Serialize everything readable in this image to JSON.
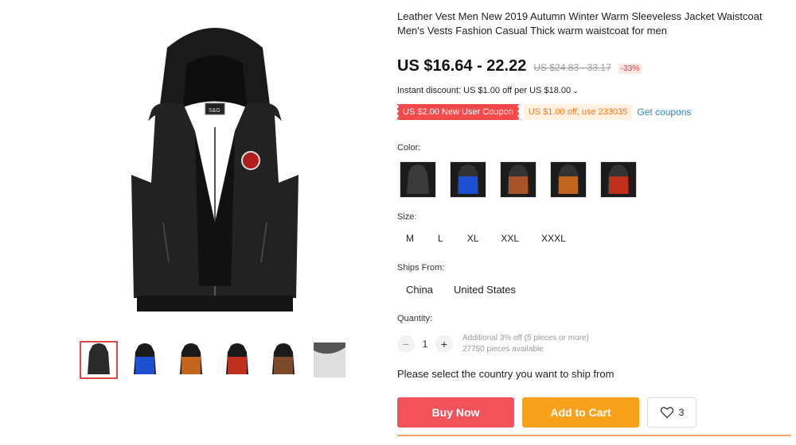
{
  "product": {
    "title": "Leather Vest Men New 2019 Autumn Winter Warm Sleeveless Jacket Waistcoat Men's Vests Fashion Casual Thick warm waistcoat for men",
    "price": "US $16.64 - 22.22",
    "old_price": "US $24.83 - 33.17",
    "discount": "-33%",
    "instant_discount": "Instant discount: US $1.00 off per US $18.00",
    "brand_tag": "S&G"
  },
  "coupons": {
    "new_user": "US $2.00 New User Coupon",
    "store": "US $1.00 off, use 233035",
    "get_label": "Get coupons"
  },
  "color": {
    "label": "Color:",
    "options": [
      {
        "name": "black",
        "color": "#2a2a2a"
      },
      {
        "name": "blue",
        "color": "#1e4fd0"
      },
      {
        "name": "brown",
        "color": "#a7542b"
      },
      {
        "name": "orange",
        "color": "#c3641f"
      },
      {
        "name": "red",
        "color": "#c0301f"
      }
    ]
  },
  "size": {
    "label": "Size:",
    "options": [
      "M",
      "L",
      "XL",
      "XXL",
      "XXXL"
    ]
  },
  "ships_from": {
    "label": "Ships From:",
    "options": [
      "China",
      "United States"
    ]
  },
  "quantity": {
    "label": "Quantity:",
    "value": "1",
    "minus": "−",
    "plus": "+",
    "note_line1": "Additional 3% off (5 pieces or more)",
    "note_line2": "27750 pieces available"
  },
  "ship_notice": "Please select the country you want to ship from",
  "actions": {
    "buy_now": "Buy Now",
    "add_to_cart": "Add to Cart",
    "wishlist_count": "3"
  },
  "thumbnails": [
    {
      "name": "black",
      "color": "#2a2a2a"
    },
    {
      "name": "blue",
      "color": "#1e4fd0"
    },
    {
      "name": "orange",
      "color": "#c3641f"
    },
    {
      "name": "red",
      "color": "#c0301f"
    },
    {
      "name": "brown",
      "color": "#7a4a2b"
    },
    {
      "name": "detail",
      "color": "#444444"
    }
  ],
  "accent_colors": {
    "buy": "#f2525a",
    "cart": "#f7a21a",
    "link": "#2e88c9"
  }
}
